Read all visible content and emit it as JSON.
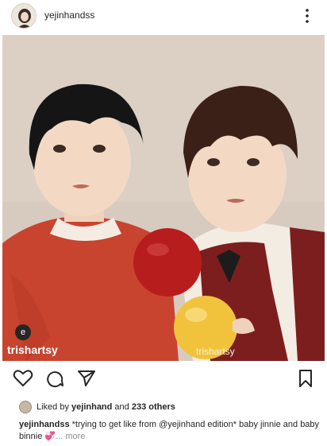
{
  "post": {
    "username": "yejinhandss",
    "watermark_left": "trishartsy",
    "watermark_right": "trishartsy",
    "watermark_badge": "e"
  },
  "likes": {
    "prefix": "Liked by ",
    "user": "yejinhand",
    "middle": " and ",
    "others": "233 others"
  },
  "caption": {
    "username": "yejinhandss",
    "text": " *trying to get like from @yejinhand edition* baby jinnie and baby binnie ",
    "emoji": "💞",
    "more": "... more"
  },
  "icons": {
    "more": "vertical-ellipsis-icon",
    "like": "heart-icon",
    "comment": "comment-bubble-icon",
    "share": "paper-plane-icon",
    "save": "bookmark-icon"
  },
  "colors": {
    "background": "#ffffff",
    "text": "#262626",
    "muted": "#8e8e8e",
    "art_bg": "#d7cbc0"
  }
}
